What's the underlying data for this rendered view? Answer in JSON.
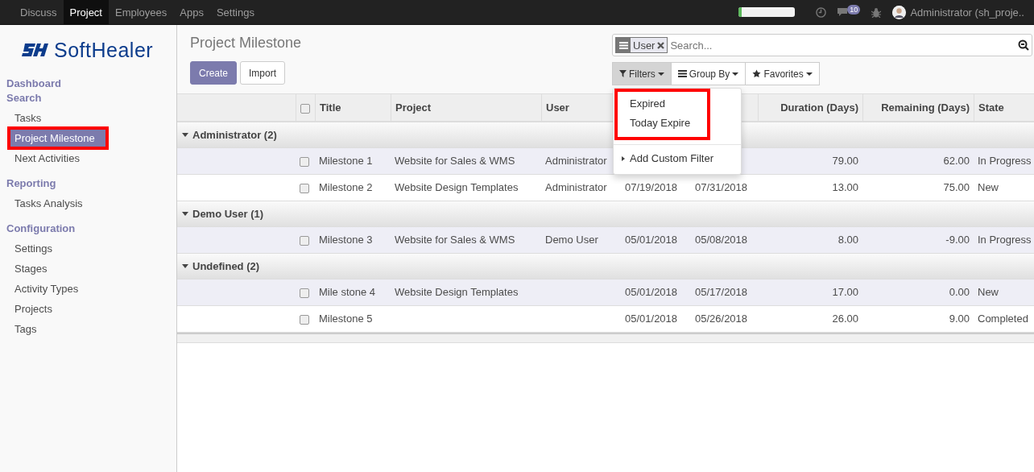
{
  "top_nav": {
    "apps": [
      {
        "label": "Discuss",
        "selected": false
      },
      {
        "label": "Project",
        "selected": true
      },
      {
        "label": "Employees",
        "selected": false
      },
      {
        "label": "Apps",
        "selected": false
      },
      {
        "label": "Settings",
        "selected": false
      }
    ],
    "progress": {
      "level": 0.05
    },
    "chat_badge": "10",
    "user": "Administrator (sh_proje.."
  },
  "sidebar": {
    "logo_text": "SoftHealer",
    "sections": [
      {
        "title": "Dashboard"
      },
      {
        "title": "Search",
        "items": [
          {
            "label": "Tasks",
            "selected": false,
            "highlighted": false
          },
          {
            "label": "Project Milestone",
            "selected": true,
            "highlighted": true
          },
          {
            "label": "Next Activities",
            "selected": false,
            "highlighted": false
          }
        ]
      },
      {
        "title": "Reporting",
        "items": [
          {
            "label": "Tasks Analysis",
            "selected": false,
            "highlighted": false
          }
        ]
      },
      {
        "title": "Configuration",
        "items": [
          {
            "label": "Settings",
            "selected": false,
            "highlighted": false
          },
          {
            "label": "Stages",
            "selected": false,
            "highlighted": false
          },
          {
            "label": "Activity Types",
            "selected": false,
            "highlighted": false
          },
          {
            "label": "Projects",
            "selected": false,
            "highlighted": false
          },
          {
            "label": "Tags",
            "selected": false,
            "highlighted": false
          }
        ]
      }
    ]
  },
  "breadcrumb": "Project Milestone",
  "buttons": [
    "Create",
    "Import"
  ],
  "search": {
    "facet": "User",
    "placeholder": "Search..."
  },
  "search_options": [
    {
      "label": "Filters",
      "kind": "filter",
      "selected": true
    },
    {
      "label": "Group By",
      "kind": "group",
      "selected": false
    },
    {
      "label": "Favorites",
      "kind": "star",
      "selected": false
    }
  ],
  "filter_menu": {
    "sections": [
      {
        "highlighted": true,
        "items": [
          "Expired",
          "Today Expire"
        ]
      }
    ],
    "custom_filter": "Add Custom Filter"
  },
  "table": {
    "select_all": {
      "checked": false
    },
    "columns": [
      {
        "label": "Title",
        "kind": "text"
      },
      {
        "label": "Project",
        "kind": "text"
      },
      {
        "label": "User",
        "kind": "text"
      },
      {
        "kind": "text"
      },
      {
        "kind": "text"
      },
      {
        "label": "Duration (Days)",
        "kind": "number"
      },
      {
        "label": "Remaining (Days)",
        "kind": "number"
      },
      {
        "label": "State",
        "kind": "text"
      }
    ],
    "groups": [
      {
        "name": "Administrator (2)",
        "expanded": true,
        "rows": [
          {
            "checked": false,
            "cells": [
              "Milestone 1",
              "Website for Sales & WMS",
              "Administrator",
              null,
              null,
              "79.00",
              "62.00",
              "In Progress"
            ]
          },
          {
            "checked": false,
            "cells": [
              "Milestone 2",
              "Website Design Templates",
              "Administrator",
              "07/19/2018",
              "07/31/2018",
              "13.00",
              "75.00",
              "New"
            ]
          }
        ]
      },
      {
        "name": "Demo User (1)",
        "expanded": true,
        "rows": [
          {
            "checked": false,
            "cells": [
              "Milestone 3",
              "Website for Sales & WMS",
              "Demo User",
              "05/01/2018",
              "05/08/2018",
              "8.00",
              "-9.00",
              "In Progress"
            ]
          }
        ]
      },
      {
        "name": "Undefined (2)",
        "expanded": true,
        "rows": [
          {
            "checked": false,
            "cells": [
              "Mile stone 4",
              "Website Design Templates",
              null,
              "05/01/2018",
              "05/17/2018",
              "17.00",
              "0.00",
              "New"
            ]
          },
          {
            "checked": false,
            "cells": [
              "Milestone 5",
              null,
              null,
              "05/01/2018",
              "05/26/2018",
              "26.00",
              "9.00",
              "Completed"
            ]
          }
        ]
      }
    ]
  }
}
